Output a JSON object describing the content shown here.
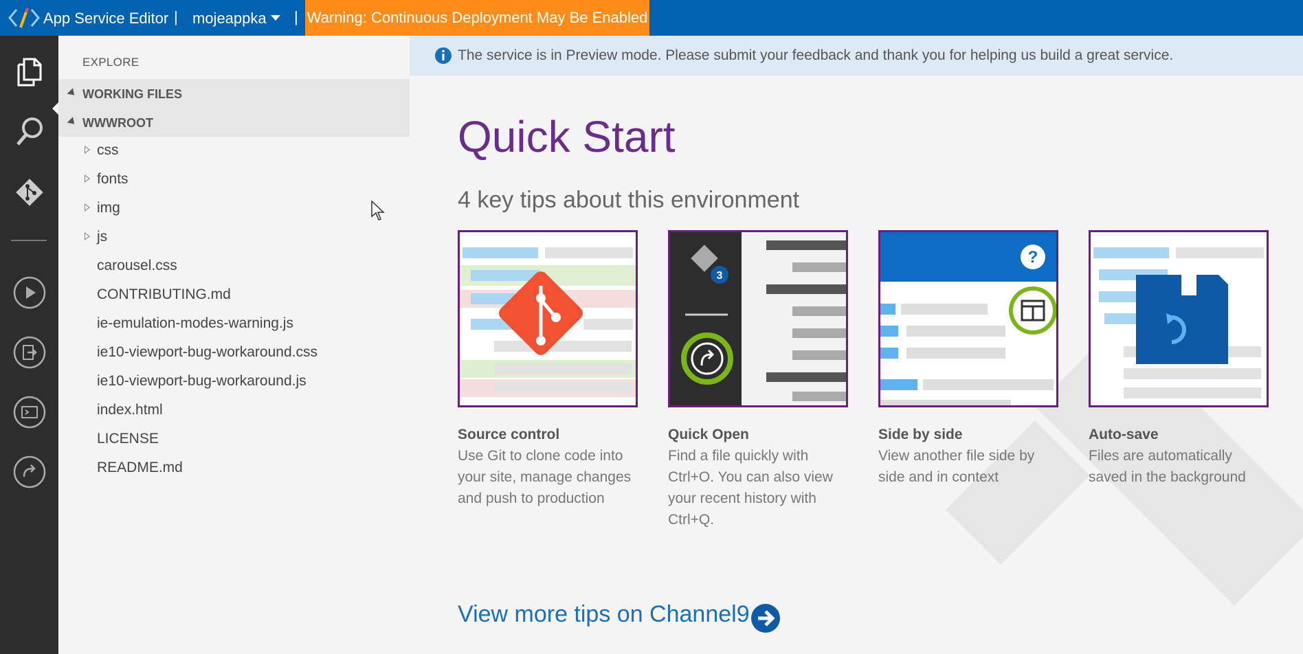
{
  "topbar": {
    "app_title": "App Service Editor",
    "separator": "|",
    "site_name": "mojeappka",
    "warning": "Warning: Continuous Deployment May Be Enabled"
  },
  "activity_bar": {
    "icons": [
      "explorer-icon",
      "search-icon",
      "git-icon",
      "run-icon",
      "output-icon",
      "console-icon",
      "open-site-icon"
    ]
  },
  "sidebar": {
    "explore_label": "EXPLORE",
    "working_files_label": "WORKING FILES",
    "root_label": "WWWROOT",
    "folders": [
      "css",
      "fonts",
      "img",
      "js"
    ],
    "files": [
      "carousel.css",
      "CONTRIBUTING.md",
      "ie-emulation-modes-warning.js",
      "ie10-viewport-bug-workaround.css",
      "ie10-viewport-bug-workaround.js",
      "index.html",
      "LICENSE",
      "README.md"
    ]
  },
  "main": {
    "info_text": "The service is in Preview mode. Please submit your feedback and thank you for helping us build a great service.",
    "title": "Quick Start",
    "subtitle": "4 key tips about this environment",
    "cards": [
      {
        "title": "Source control",
        "desc": "Use Git to clone code into your site, manage changes and push to production"
      },
      {
        "title": "Quick Open",
        "desc": "Find a file quickly with Ctrl+O. You can also view your recent history with Ctrl+Q."
      },
      {
        "title": "Side by side",
        "desc": "View another file side by side and in context"
      },
      {
        "title": "Auto-save",
        "desc": "Files are automatically saved in the background"
      }
    ],
    "more_tips": "View more tips on Channel9",
    "quick_open_badge": "3"
  },
  "colors": {
    "topbar": "#0062b0",
    "warning": "#ff8c19",
    "title_purple": "#6a2e8a",
    "link_blue": "#1b6fb6"
  }
}
